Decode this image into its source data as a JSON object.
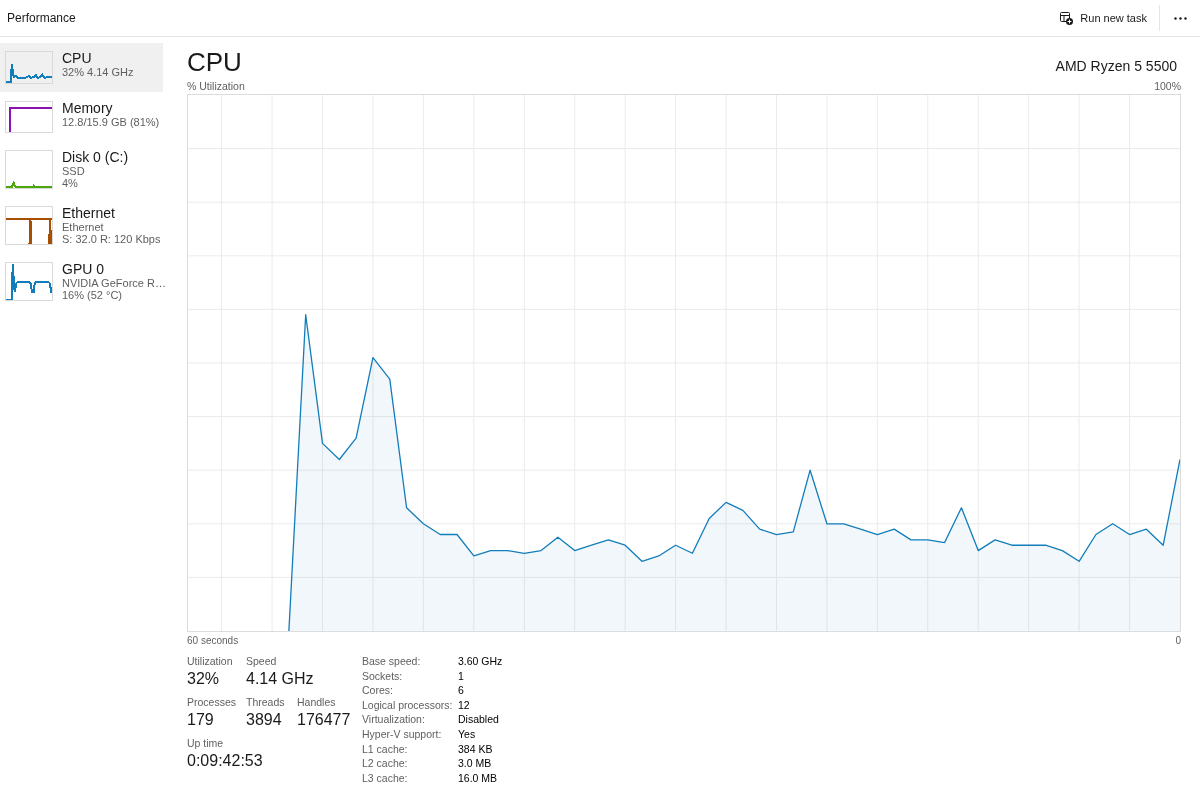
{
  "header": {
    "title": "Performance",
    "run_new_task": "Run new task"
  },
  "sidebar": {
    "items": [
      {
        "kind": "cpu",
        "name": "CPU",
        "details": [
          "32% 4.14 GHz"
        ],
        "selected": true,
        "color": "#117dbb"
      },
      {
        "kind": "memory",
        "name": "Memory",
        "details": [
          "12.8/15.9 GB (81%)"
        ],
        "selected": false,
        "color": "#8b12ae"
      },
      {
        "kind": "disk",
        "name": "Disk 0 (C:)",
        "details": [
          "SSD",
          "4%"
        ],
        "selected": false,
        "color": "#4da60c"
      },
      {
        "kind": "network",
        "name": "Ethernet",
        "details": [
          "Ethernet",
          "S: 32.0 R: 120 Kbps"
        ],
        "selected": false,
        "color": "#a74f01"
      },
      {
        "kind": "gpu",
        "name": "GPU 0",
        "details": [
          "NVIDIA GeForce R…",
          "16% (52 °C)"
        ],
        "selected": false,
        "color": "#117dbb"
      }
    ]
  },
  "main": {
    "title": "CPU",
    "processor": "AMD Ryzen 5 5500",
    "utilization_graph": {
      "label": "% Utilization",
      "top_label": "100%",
      "start_label": "60 seconds",
      "end_label": "0"
    },
    "stats": [
      [
        {
          "label": "Utilization",
          "value": "32%"
        },
        {
          "label": "Speed",
          "value": "4.14 GHz"
        }
      ],
      [
        {
          "label": "Processes",
          "value": "179"
        },
        {
          "label": "Threads",
          "value": "3894"
        },
        {
          "label": "Handles",
          "value": "176477"
        }
      ],
      [
        {
          "label": "Up time",
          "value": "0:09:42:53"
        }
      ]
    ],
    "specs": [
      {
        "label": "Base speed:",
        "value": "3.60 GHz"
      },
      {
        "label": "Sockets:",
        "value": "1"
      },
      {
        "label": "Cores:",
        "value": "6"
      },
      {
        "label": "Logical processors:",
        "value": "12"
      },
      {
        "label": "Virtualization:",
        "value": "Disabled"
      },
      {
        "label": "Hyper-V support:",
        "value": "Yes"
      },
      {
        "label": "L1 cache:",
        "value": "384 KB"
      },
      {
        "label": "L2 cache:",
        "value": "3.0 MB"
      },
      {
        "label": "L3 cache:",
        "value": "16.0 MB"
      }
    ]
  }
}
